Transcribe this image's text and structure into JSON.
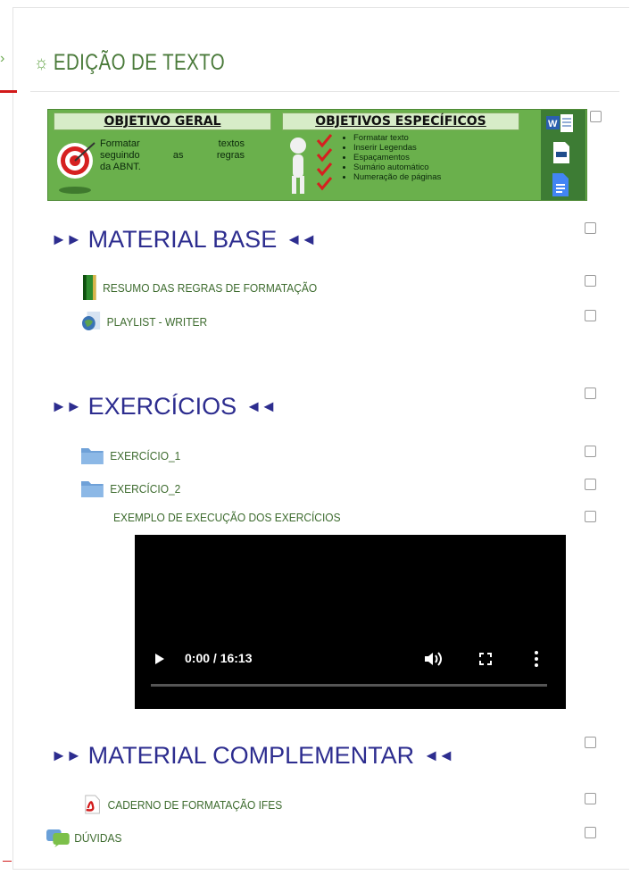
{
  "section": {
    "icon": "sun-icon",
    "title": "EDIÇÃO DE TEXTO"
  },
  "banner": {
    "general_heading": "OBJETIVO GERAL",
    "general_text": [
      "Formatar textos",
      "seguindo as regras",
      "da ABNT."
    ],
    "specific_heading": "OBJETIVOS ESPECÍFICOS",
    "specific_items": [
      "Formatar texto",
      "Inserir Legendas",
      "Espaçamentos",
      "Sumário automático",
      "Numeração de páginas"
    ]
  },
  "headings": {
    "material_base": "MATERIAL BASE",
    "exercicios": "EXERCÍCIOS",
    "material_complementar": "MATERIAL COMPLEMENTAR"
  },
  "activities": {
    "resumo": "RESUMO DAS REGRAS DE FORMATAÇÃO",
    "playlist": "PLAYLIST - WRITER",
    "exercicio1": "EXERCÍCIO_1",
    "exercicio2": "EXERCÍCIO_2",
    "exemplo": "EXEMPLO DE EXECUÇÃO DOS EXERCÍCIOS",
    "caderno": "CADERNO DE FORMATAÇÃO IFES",
    "duvidas": "DÚVIDAS"
  },
  "video": {
    "time": "0:00 / 16:13",
    "progress": 0
  },
  "colors": {
    "accent_green": "#4a7a3a",
    "heading_blue": "#2d2d8f",
    "link_green": "#3d6b2e",
    "banner_green": "#6ab04c"
  }
}
